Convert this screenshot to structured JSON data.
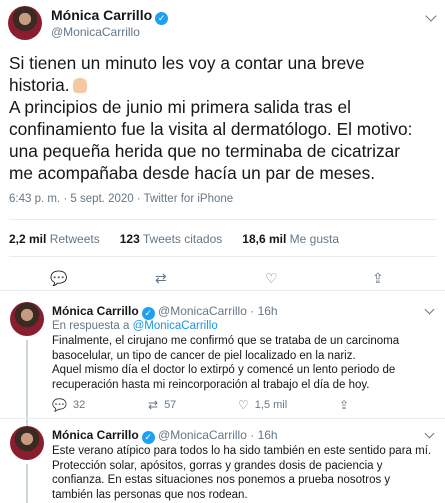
{
  "main_tweet": {
    "display_name": "Mónica Carrillo",
    "handle": "@MonicaCarrillo",
    "text_lines": [
      "Si tienen un minuto les voy a contar una breve",
      "historia.",
      "A principios de junio mi primera salida tras el",
      "confinamiento fue la visita al dermatólogo. El motivo:",
      "una pequeña herida que no terminaba de cicatrizar",
      "me acompañaba desde hacía un par de meses."
    ],
    "timestamp": "6:43 p. m. · 5 sept. 2020 · Twitter for iPhone",
    "stats": {
      "retweets_count": "2,2 mil",
      "retweets_label": "Retweets",
      "quotes_count": "123",
      "quotes_label": "Tweets citados",
      "likes_count": "18,6 mil",
      "likes_label": "Me gusta"
    }
  },
  "replies": [
    {
      "display_name": "Mónica Carrillo",
      "handle_time": "@MonicaCarrillo · 16h",
      "in_reply_prefix": "En respuesta a",
      "in_reply_handle": "@MonicaCarrillo",
      "text_lines": [
        "Finalmente, el cirujano me confirmó que se trataba de un carcinoma",
        "basocelular, un tipo de cancer de piel localizado en la nariz.",
        "Aquel mismo día el doctor lo extirpó y comencé un lento periodo de",
        "recuperación hasta mi reincorporación al trabajo el día de hoy."
      ],
      "reply_count": "32",
      "retweet_count": "57",
      "like_count": "1,5 mil"
    },
    {
      "display_name": "Mónica Carrillo",
      "handle_time": "@MonicaCarrillo · 16h",
      "text_lines": [
        "Este verano atípico para todos lo ha sido también en este sentido para mí.",
        "Protección solar, apósitos, gorras y grandes dosis de paciencia y",
        "confianza. En estas situaciones nos ponemos a prueba nosotros y",
        "también las personas que nos rodean."
      ]
    }
  ],
  "colors": {
    "accent": "#1da1f2",
    "link": "#1b95e0",
    "secondary_text": "#657786"
  }
}
